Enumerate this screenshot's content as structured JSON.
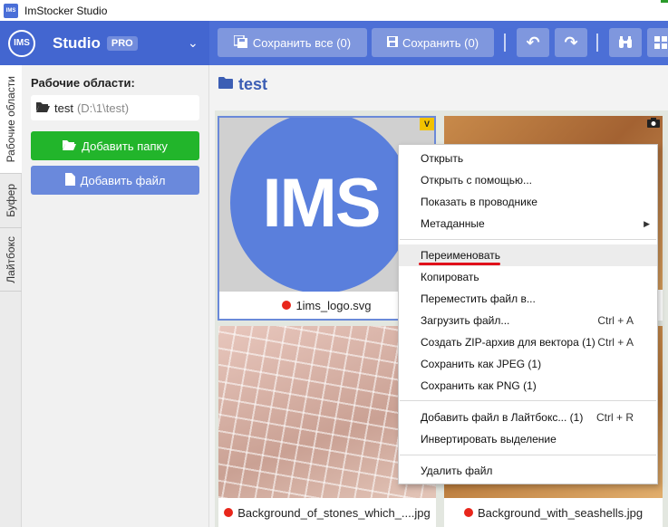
{
  "window": {
    "title": "ImStocker Studio",
    "app_icon_text": "IMS"
  },
  "header": {
    "logo_text": "IMS",
    "brand": "Studio",
    "badge": "PRO",
    "chevron": "⌄",
    "save_all_label": "Сохранить все (0)",
    "save_label": "Сохранить (0)",
    "undo_icon": "↶",
    "redo_icon": "↷",
    "binoculars_icon": "⌕",
    "colors": {
      "header_bg": "#4c6fd6",
      "button_bg": "#7f97de"
    }
  },
  "vtabs": [
    "Рабочие области",
    "Буфер",
    "Лайтбокс"
  ],
  "sidebar": {
    "workspaces_label": "Рабочие области:",
    "workspace": {
      "name": "test",
      "path": "(D:\\1\\test)"
    },
    "add_folder_label": "Добавить папку",
    "add_file_label": "Добавить файл",
    "colors": {
      "add_folder": "#22b52b",
      "add_file": "#6a89dc"
    }
  },
  "main": {
    "folder_title": "test",
    "files": [
      {
        "name": "1ims_logo.svg",
        "thumb_text": "IMS",
        "badge": "V",
        "status_color": "#e8261b"
      },
      {
        "name": "",
        "badge": "camera-icon"
      },
      {
        "name": "Background_of_stones_which_....jpg",
        "status_color": "#e8261b"
      },
      {
        "name": "Background_with_seashells.jpg",
        "status_color": "#e8261b"
      }
    ]
  },
  "context_menu": {
    "items": [
      {
        "label": "Открыть",
        "shortcut": ""
      },
      {
        "label": "Открыть с помощью...",
        "shortcut": ""
      },
      {
        "label": "Показать в проводнике",
        "shortcut": ""
      },
      {
        "label": "Метаданные",
        "shortcut": "",
        "submenu": "▶"
      },
      {
        "label": "Переименовать",
        "shortcut": "",
        "highlighted": true
      },
      {
        "label": "Копировать",
        "shortcut": ""
      },
      {
        "label": "Переместить файл в...",
        "shortcut": ""
      },
      {
        "label": "Загрузить файл...",
        "shortcut": "Ctrl + A"
      },
      {
        "label": "Создать ZIP-архив для вектора (1)",
        "shortcut": "Ctrl + A"
      },
      {
        "label": "Сохранить как JPEG (1)",
        "shortcut": ""
      },
      {
        "label": "Сохранить как PNG (1)",
        "shortcut": ""
      },
      {
        "label": "Добавить файл в Лайтбокс... (1)",
        "shortcut": "Ctrl + R"
      },
      {
        "label": "Инвертировать выделение",
        "shortcut": ""
      },
      {
        "label": "Удалить файл",
        "shortcut": ""
      }
    ]
  }
}
